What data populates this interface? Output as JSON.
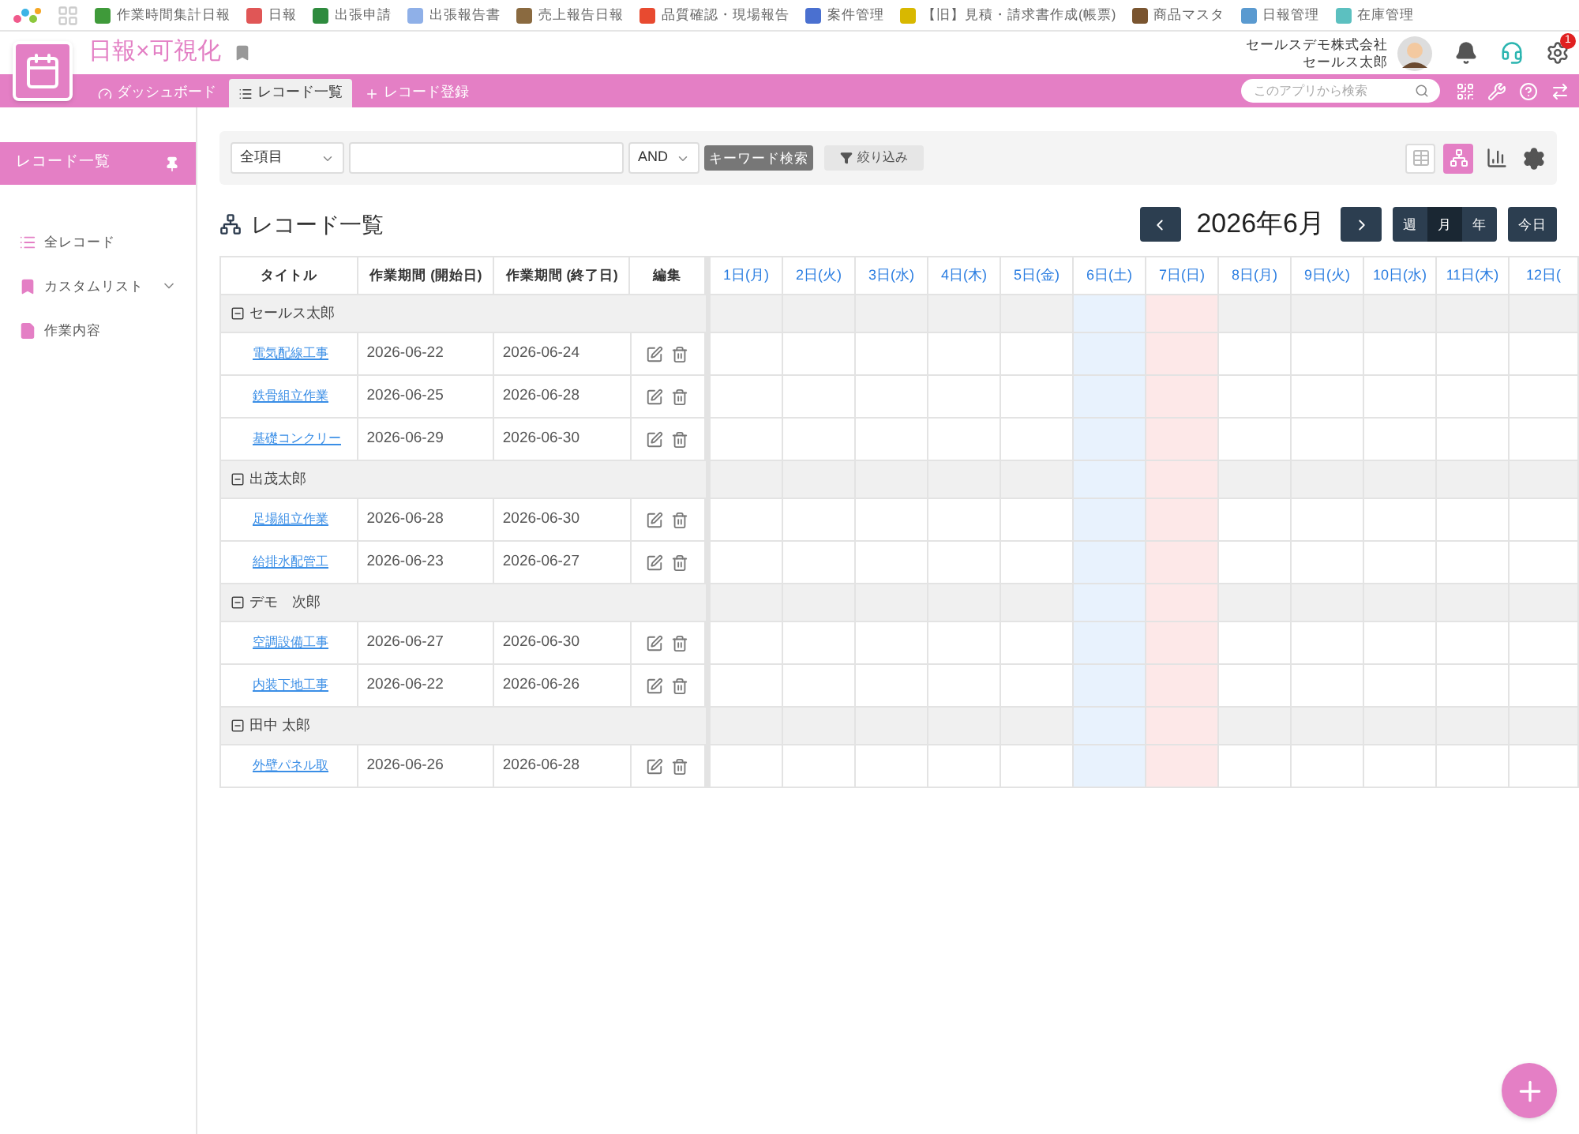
{
  "app_bar": {
    "apps": [
      {
        "label": "作業時間集計日報",
        "color": "#3f9a3a"
      },
      {
        "label": "日報",
        "color": "#e05656"
      },
      {
        "label": "出張申請",
        "color": "#2e8b3e"
      },
      {
        "label": "出張報告書",
        "color": "#8fb0e8"
      },
      {
        "label": "売上報告日報",
        "color": "#8a6a40"
      },
      {
        "label": "品質確認・現場報告",
        "color": "#e84a30"
      },
      {
        "label": "案件管理",
        "color": "#4a70d0"
      },
      {
        "label": "【旧】見積・請求書作成(帳票)",
        "color": "#d8b800"
      },
      {
        "label": "商品マスタ",
        "color": "#7a5530"
      },
      {
        "label": "日報管理",
        "color": "#5a9ad0"
      },
      {
        "label": "在庫管理",
        "color": "#5cc0c0"
      }
    ]
  },
  "header": {
    "app_title": "日報×可視化",
    "company": "セールスデモ株式会社",
    "user": "セールス太郎",
    "notification_badge": "1"
  },
  "nav": {
    "tabs": [
      {
        "label": "ダッシュボード",
        "selected": false
      },
      {
        "label": "レコード一覧",
        "selected": true
      },
      {
        "label": "レコード登録",
        "selected": false
      }
    ],
    "search": {
      "placeholder": "このアプリから検索"
    }
  },
  "sidebar": {
    "title": "レコード一覧",
    "items": [
      {
        "label": "全レコード",
        "expandable": false
      },
      {
        "label": "カスタムリスト",
        "expandable": true
      },
      {
        "label": "作業内容",
        "expandable": false
      }
    ]
  },
  "filter": {
    "field_select": "全項目",
    "operator_select": "AND",
    "search_button": "キーワード検索",
    "filter_button": "絞り込み",
    "views": [
      {
        "kind": "table",
        "selected": false
      },
      {
        "kind": "tree",
        "selected": true
      },
      {
        "kind": "chart",
        "selected": false
      }
    ]
  },
  "page_title": "レコード一覧",
  "calendar": {
    "month": "2026年6月",
    "modes": [
      {
        "label": "週",
        "selected": false
      },
      {
        "label": "月",
        "selected": true
      },
      {
        "label": "年",
        "selected": false
      }
    ],
    "today": "今日",
    "days": [
      {
        "label": "1日(月)",
        "kind": "weekday"
      },
      {
        "label": "2日(火)",
        "kind": "weekday"
      },
      {
        "label": "3日(水)",
        "kind": "weekday"
      },
      {
        "label": "4日(木)",
        "kind": "weekday"
      },
      {
        "label": "5日(金)",
        "kind": "weekday"
      },
      {
        "label": "6日(土)",
        "kind": "saturday"
      },
      {
        "label": "7日(日)",
        "kind": "sunday"
      },
      {
        "label": "8日(月)",
        "kind": "weekday"
      },
      {
        "label": "9日(火)",
        "kind": "weekday"
      },
      {
        "label": "10日(水)",
        "kind": "weekday"
      },
      {
        "label": "11日(木)",
        "kind": "weekday"
      },
      {
        "label": "12日(",
        "kind": "weekday"
      }
    ]
  },
  "table": {
    "columns": [
      "タイトル",
      "作業期間 (開始日)",
      "作業期間 (終了日)",
      "編集"
    ],
    "groups": [
      {
        "name": "セールス太郎",
        "expanded": true,
        "rows": [
          {
            "title": "電気配線工事",
            "start": "2026-06-22",
            "end": "2026-06-24"
          },
          {
            "title": "鉄骨組立作業",
            "start": "2026-06-25",
            "end": "2026-06-28"
          },
          {
            "title": "基礎コンクリー",
            "start": "2026-06-29",
            "end": "2026-06-30"
          }
        ]
      },
      {
        "name": "出茂太郎",
        "expanded": true,
        "rows": [
          {
            "title": "足場組立作業",
            "start": "2026-06-28",
            "end": "2026-06-30"
          },
          {
            "title": "給排水配管工",
            "start": "2026-06-23",
            "end": "2026-06-27"
          }
        ]
      },
      {
        "name": "デモ　次郎",
        "expanded": true,
        "rows": [
          {
            "title": "空調設備工事",
            "start": "2026-06-27",
            "end": "2026-06-30"
          },
          {
            "title": "内装下地工事",
            "start": "2026-06-22",
            "end": "2026-06-26"
          }
        ]
      },
      {
        "name": "田中 太郎",
        "expanded": true,
        "rows": [
          {
            "title": "外壁パネル取",
            "start": "2026-06-26",
            "end": "2026-06-28"
          }
        ]
      }
    ]
  }
}
